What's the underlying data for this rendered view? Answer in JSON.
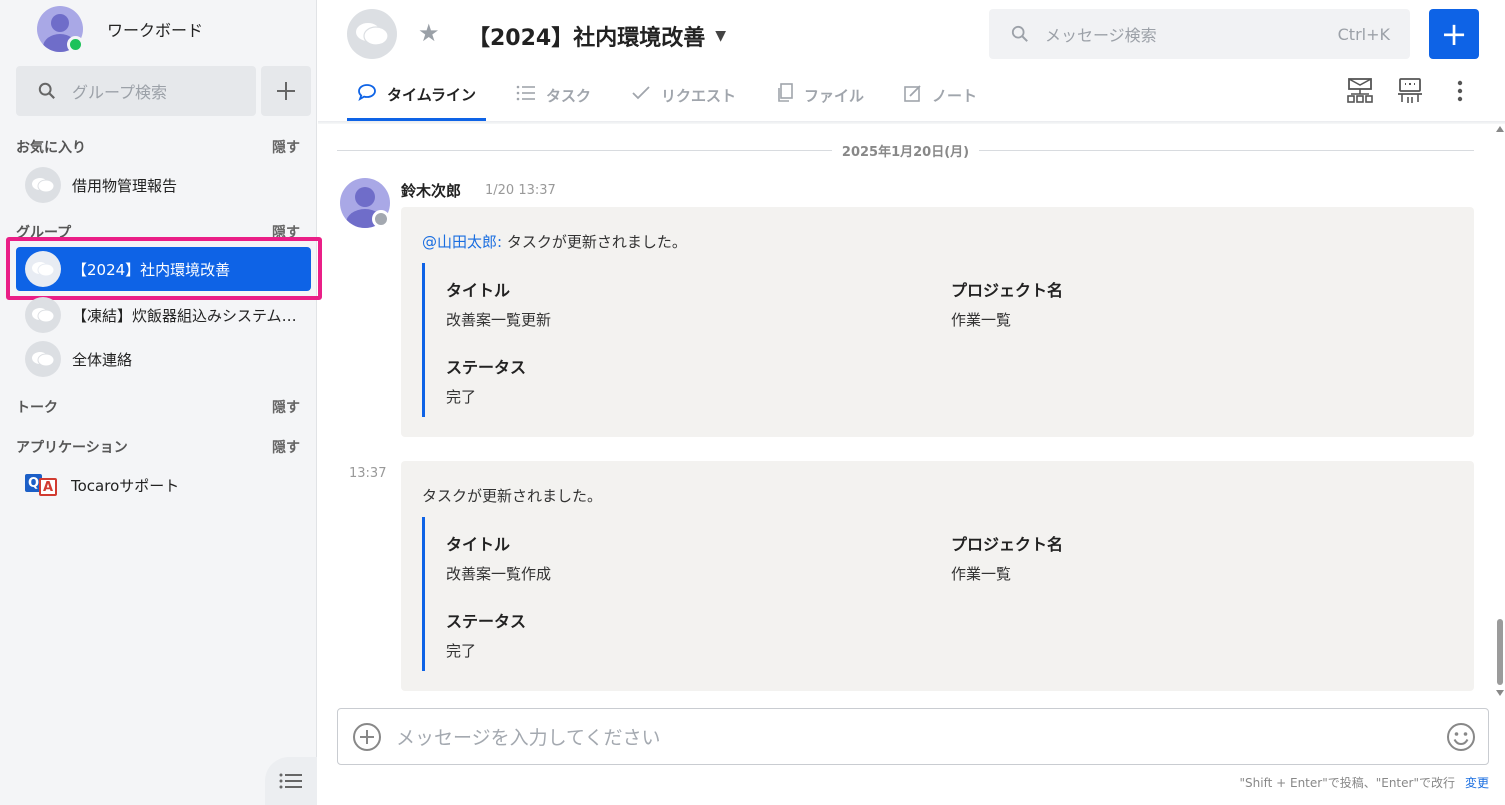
{
  "sidebar": {
    "profile_name": "ワークボード",
    "search_placeholder": "グループ検索",
    "sections": {
      "favorites": {
        "title": "お気に入り",
        "hide": "隠す",
        "items": [
          {
            "label": "借用物管理報告"
          }
        ]
      },
      "groups": {
        "title": "グループ",
        "hide": "隠す",
        "items": [
          {
            "label": "【2024】社内環境改善",
            "active": true
          },
          {
            "label": "【凍結】炊飯器組込みシステム開発"
          },
          {
            "label": "全体連絡"
          }
        ]
      },
      "talk": {
        "title": "トーク",
        "hide": "隠す"
      },
      "apps": {
        "title": "アプリケーション",
        "hide": "隠す",
        "items": [
          {
            "label": "Tocaroサポート",
            "logo_q": "Q",
            "logo_a": "A"
          }
        ]
      }
    }
  },
  "header": {
    "room_title": "【2024】社内環境改善",
    "search_placeholder": "メッセージ検索",
    "search_shortcut": "Ctrl+K",
    "new_label": "+",
    "tabs": [
      {
        "label": "タイムライン",
        "icon": "speech-bubble-icon",
        "active": true
      },
      {
        "label": "タスク",
        "icon": "list-icon"
      },
      {
        "label": "リクエスト",
        "icon": "checkmark-icon"
      },
      {
        "label": "ファイル",
        "icon": "file-icon"
      },
      {
        "label": "ノート",
        "icon": "note-icon"
      }
    ]
  },
  "timeline": {
    "date_separator": "2025年1月20日(月)",
    "author": "鈴木次郎",
    "timestamp": "1/20 13:37",
    "messages": [
      {
        "mention": "@山田太郎:",
        "text": " タスクが更新されました。",
        "fields": {
          "title_key": "タイトル",
          "title_val": "改善案一覧更新",
          "project_key": "プロジェクト名",
          "project_val": "作業一覧",
          "status_key": "ステータス",
          "status_val": "完了"
        }
      },
      {
        "side_time": "13:37",
        "text": "タスクが更新されました。",
        "fields": {
          "title_key": "タイトル",
          "title_val": "改善案一覧作成",
          "project_key": "プロジェクト名",
          "project_val": "作業一覧",
          "status_key": "ステータス",
          "status_val": "完了"
        }
      }
    ]
  },
  "composer": {
    "placeholder": "メッセージを入力してください",
    "hint": "\"Shift + Enter\"で投稿、\"Enter\"で改行",
    "change_label": "変更"
  },
  "colors": {
    "accent": "#0e63e6",
    "highlight": "#ea1f87",
    "online": "#1ec25a"
  }
}
